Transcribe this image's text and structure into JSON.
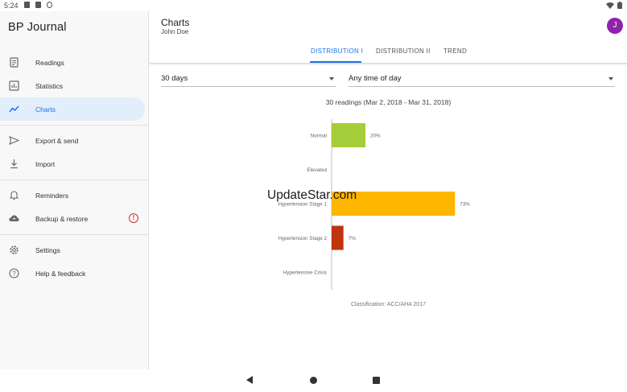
{
  "status_bar": {
    "time": "5:24",
    "icons": [
      "notification-icon",
      "storage-icon",
      "sync-icon",
      "wifi-icon",
      "battery-icon"
    ]
  },
  "app": {
    "title": "BP Journal"
  },
  "sidebar": {
    "items": [
      {
        "label": "Readings",
        "icon": "readings-icon"
      },
      {
        "label": "Statistics",
        "icon": "statistics-icon"
      },
      {
        "label": "Charts",
        "icon": "charts-icon",
        "active": true
      },
      {
        "label": "Export & send",
        "icon": "send-icon"
      },
      {
        "label": "Import",
        "icon": "download-icon"
      },
      {
        "label": "Reminders",
        "icon": "bell-icon"
      },
      {
        "label": "Backup & restore",
        "icon": "cloud-upload-icon",
        "alert": "!"
      },
      {
        "label": "Settings",
        "icon": "gear-icon"
      },
      {
        "label": "Help & feedback",
        "icon": "help-icon"
      }
    ]
  },
  "header": {
    "title": "Charts",
    "subtitle": "John Doe",
    "avatar_letter": "J"
  },
  "tabs": [
    {
      "label": "DISTRIBUTION I",
      "active": true
    },
    {
      "label": "DISTRIBUTION II"
    },
    {
      "label": "TREND"
    }
  ],
  "filters": {
    "period": "30 days",
    "time_of_day": "Any time of day"
  },
  "chart_caption": "30 readings (Mar 2, 2018 - Mar 31, 2018)",
  "classification": "Classification: ACC/AHA 2017",
  "watermark": "UpdateStar.com",
  "colors": {
    "accent": "#1a73e8",
    "normal": "#a5cd39",
    "stage1": "#ffb600",
    "stage2": "#c0330f",
    "avatar": "#8e24aa"
  },
  "chart_data": {
    "type": "bar",
    "orientation": "horizontal",
    "categories": [
      "Normal",
      "Elevated",
      "Hypertension Stage 1",
      "Hypertension Stage 2",
      "Hypertensive Crisis"
    ],
    "values": [
      20,
      0,
      73,
      7,
      0
    ],
    "labels": [
      "20%",
      "",
      "73%",
      "7%",
      ""
    ],
    "colors": [
      "#a5cd39",
      "#a5cd39",
      "#ffb600",
      "#c0330f",
      "#c0330f"
    ],
    "unit": "%",
    "xlim": [
      0,
      100
    ]
  }
}
